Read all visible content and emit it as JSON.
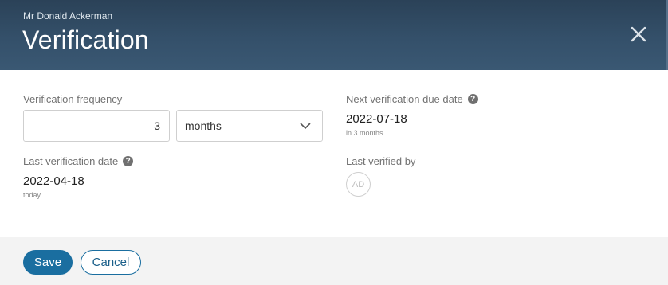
{
  "header": {
    "subtitle": "Mr Donald Ackerman",
    "title": "Verification",
    "close_icon": "close-icon"
  },
  "frequency": {
    "label": "Verification frequency",
    "value": "3",
    "unit_selected": "months",
    "unit_icon": "chevron-down-icon"
  },
  "next_due": {
    "label": "Next verification due date",
    "help_icon": "question-circle-icon",
    "value": "2022-07-18",
    "hint": "in 3 months"
  },
  "last_date": {
    "label": "Last verification date",
    "help_icon": "question-circle-icon",
    "value": "2022-04-18",
    "hint": "today"
  },
  "last_by": {
    "label": "Last verified by",
    "initials": "AD"
  },
  "footer": {
    "save_label": "Save",
    "cancel_label": "Cancel"
  },
  "colors": {
    "header_bg": "#34506a",
    "primary": "#1a6ea0",
    "footer_bg": "#f3f3f3"
  }
}
